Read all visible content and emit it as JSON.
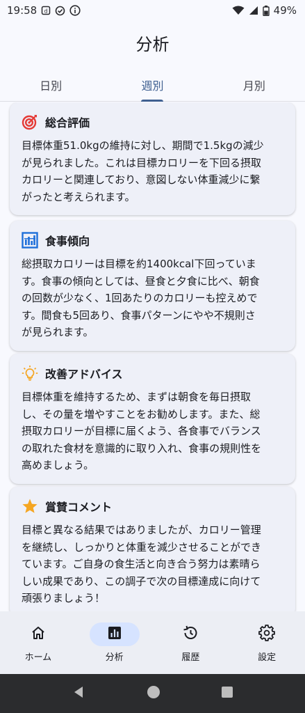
{
  "status_bar": {
    "time": "19:58",
    "battery": "49%"
  },
  "app_bar": {
    "title": "分析"
  },
  "tabs": [
    {
      "label": "日別",
      "active": false
    },
    {
      "label": "週別",
      "active": true
    },
    {
      "label": "月別",
      "active": false
    }
  ],
  "cards": [
    {
      "icon": "target-icon",
      "title": "総合評価",
      "lines": [
        "目標体重51.0kgの維持に対し、期間で1.5kgの減少",
        "が見られました。これは目標カロリーを下回る摂取",
        "カロリーと関連しており、意図しない体重減少に繋",
        "がったと考えられます。"
      ]
    },
    {
      "icon": "bar-chart-icon",
      "title": "食事傾向",
      "lines": [
        "総摂取カロリーは目標を約1400kcal下回っていま",
        "す。食事の傾向としては、昼食と夕食に比べ、朝食",
        "の回数が少なく、1回あたりのカロリーも控えめで",
        "す。間食も5回あり、食事パターンにやや不規則さ",
        "が見られます。"
      ]
    },
    {
      "icon": "lightbulb-icon",
      "title": "改善アドバイス",
      "lines": [
        "目標体重を維持するため、まずは朝食を毎日摂取",
        "し、その量を増やすことをお勧めします。また、総",
        "摂取カロリーが目標に届くよう、各食事でバランス",
        "の取れた食材を意識的に取り入れ、食事の規則性を",
        "高めましょう。"
      ]
    },
    {
      "icon": "star-icon",
      "title": "賞賛コメント",
      "lines": [
        "目標と異なる結果ではありましたが、カロリー管理",
        "を継続し、しっかりと体重を減少させることができ",
        "ています。ご自身の食生活と向き合う努力は素晴ら",
        "しい成果であり、この調子で次の目標達成に向けて",
        "頑張りましょう！"
      ]
    }
  ],
  "bottom_nav": [
    {
      "label": "ホーム",
      "icon": "home-icon",
      "active": false
    },
    {
      "label": "分析",
      "icon": "analytics-icon",
      "active": true
    },
    {
      "label": "履歴",
      "icon": "history-icon",
      "active": false
    },
    {
      "label": "設定",
      "icon": "settings-icon",
      "active": false
    }
  ],
  "colors": {
    "accent": "#3e5f90",
    "card_bg": "#eef0f8",
    "nav_active": "#d6e3ff",
    "target": "#e53935",
    "chart": "#1e6fd9",
    "bulb": "#f5a623",
    "star": "#f5a623"
  }
}
